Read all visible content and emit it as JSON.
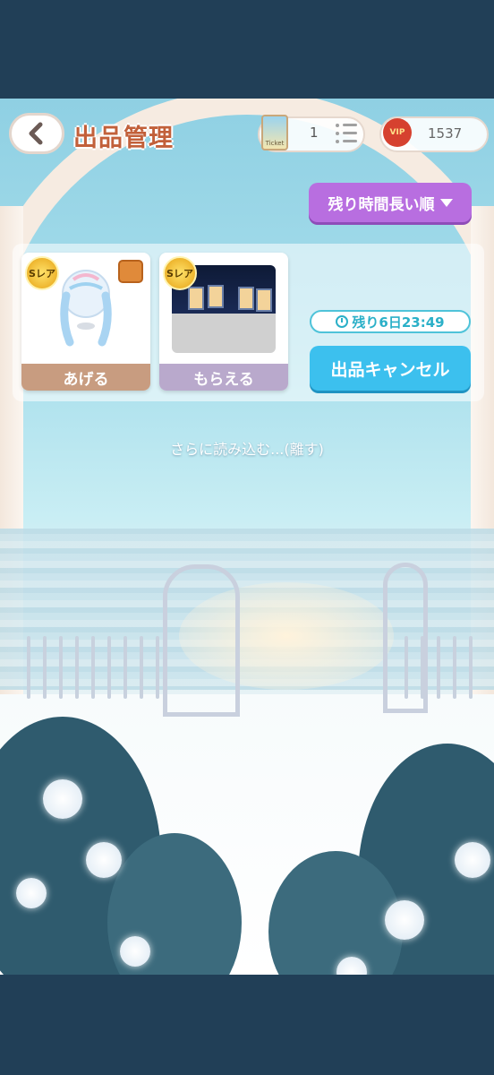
{
  "header": {
    "title": "出品管理",
    "ticket_label": "Ticket",
    "ticket_count": "1",
    "vip_label": "VIP",
    "points": "1537"
  },
  "sort": {
    "label": "残り時間長い順"
  },
  "listing": {
    "give_card": {
      "rarity": "Sレア",
      "label": "あげる"
    },
    "get_card": {
      "rarity": "Sレア",
      "label": "もらえる"
    },
    "remaining_time": "残り6日23:49",
    "cancel_label": "出品キャンセル"
  },
  "load_more": "さらに読み込む...(離す)",
  "colors": {
    "title": "#c2603a",
    "sort_button": "#b86ee0",
    "cancel_button": "#3cc0ee",
    "timer_text": "#2bb0c8",
    "system_bar": "#213f57"
  }
}
